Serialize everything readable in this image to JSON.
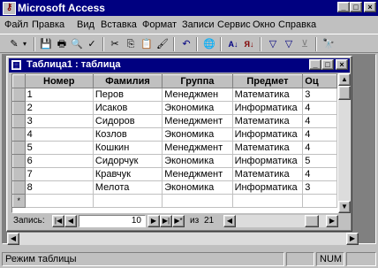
{
  "app": {
    "title": "Microsoft Access",
    "caption_buttons": [
      "_",
      "□",
      "×"
    ]
  },
  "menu": [
    "Файл",
    "Правка",
    "Вид",
    "Вставка",
    "Формат",
    "Записи",
    "Сервис",
    "Окно",
    "Справка"
  ],
  "toolbar": {
    "icons": [
      "design-view-icon",
      "save-icon",
      "print-icon",
      "print-preview-icon",
      "spelling-icon",
      "cut-icon",
      "copy-icon",
      "paste-icon",
      "format-painter-icon",
      "undo-icon",
      "insert-hyperlink-icon",
      "sort-ascending-icon",
      "sort-descending-icon",
      "filter-by-selection-icon",
      "filter-by-form-icon",
      "apply-filter-icon",
      "find-icon"
    ],
    "glyphs": [
      "✎",
      "▾",
      "💾",
      "🖶",
      "🔍",
      "✓",
      "✂",
      "⎘",
      "📋",
      "🖌",
      "↶",
      "🌐",
      "A↓",
      "Я↓",
      "▽",
      "▽",
      "⊻",
      "🔭"
    ]
  },
  "table_window": {
    "title": "Таблица1 : таблица",
    "columns": [
      "Номер",
      "Фамилия",
      "Группа",
      "Предмет",
      "Оц"
    ],
    "rows": [
      [
        "1",
        "Перов",
        "Менеджмен",
        "Математика",
        "3"
      ],
      [
        "2",
        "Исаков",
        "Экономика",
        "Информатика",
        "4"
      ],
      [
        "3",
        "Сидоров",
        "Менеджмент",
        "Математика",
        "4"
      ],
      [
        "4",
        "Козлов",
        "Экономика",
        "Информатика",
        "4"
      ],
      [
        "5",
        "Кошкин",
        "Менеджмент",
        "Математика",
        "4"
      ],
      [
        "6",
        "Сидорчук",
        "Экономика",
        "Информатика",
        "5"
      ],
      [
        "7",
        "Кравчук",
        "Менеджмент",
        "Математика",
        "4"
      ],
      [
        "8",
        "Мелота",
        "Экономика",
        "Информатика",
        "3"
      ],
      [
        "",
        "",
        "",
        "",
        ""
      ]
    ],
    "new_row_marker": "*",
    "nav": {
      "label": "Запись:",
      "current": "10",
      "of_label": "из",
      "total": "21"
    }
  },
  "status": {
    "mode": "Режим таблицы",
    "num": "NUM"
  }
}
